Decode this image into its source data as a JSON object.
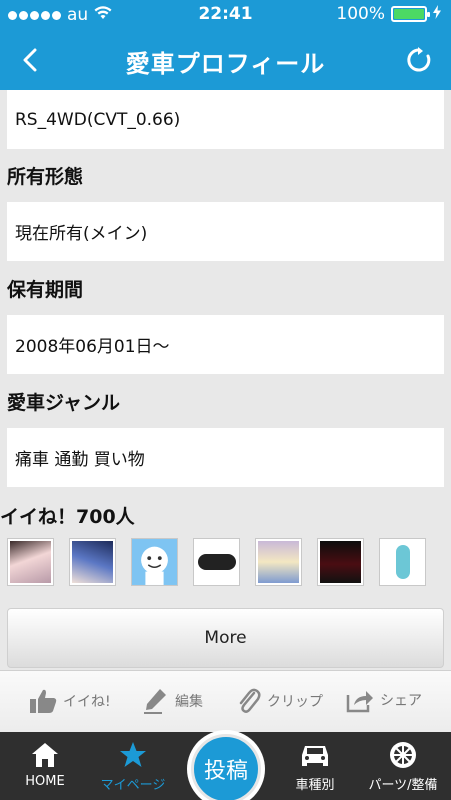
{
  "status": {
    "carrier": "au",
    "time": "22:41",
    "battery": "100%",
    "battery_level": 1.0
  },
  "navbar": {
    "title": "愛車プロフィール"
  },
  "profile": {
    "grade": "RS_4WD(CVT_0.66)",
    "ownership_label": "所有形態",
    "ownership_value": "現在所有(メイン)",
    "period_label": "保有期間",
    "period_value": "2008年06月01日〜",
    "genre_label": "愛車ジャンル",
    "genre_value": "痛車 通勤 買い物"
  },
  "likes": {
    "heading": "イイね！700人",
    "more_label": "More",
    "thumbs": [
      "user-avatar-1",
      "user-avatar-2",
      "user-avatar-3",
      "user-avatar-4",
      "user-avatar-5",
      "user-avatar-6",
      "user-avatar-7"
    ]
  },
  "actions": {
    "like": "イイね!",
    "edit": "編集",
    "clip": "クリップ",
    "share": "シェア"
  },
  "tabs": {
    "home": "HOME",
    "mypage": "マイページ",
    "post": "投稿",
    "cars": "車種別",
    "parts": "パーツ/整備"
  },
  "colors": {
    "brand": "#1c9ad6",
    "tabbar": "#2f2f2f",
    "battery": "#4cd964"
  }
}
